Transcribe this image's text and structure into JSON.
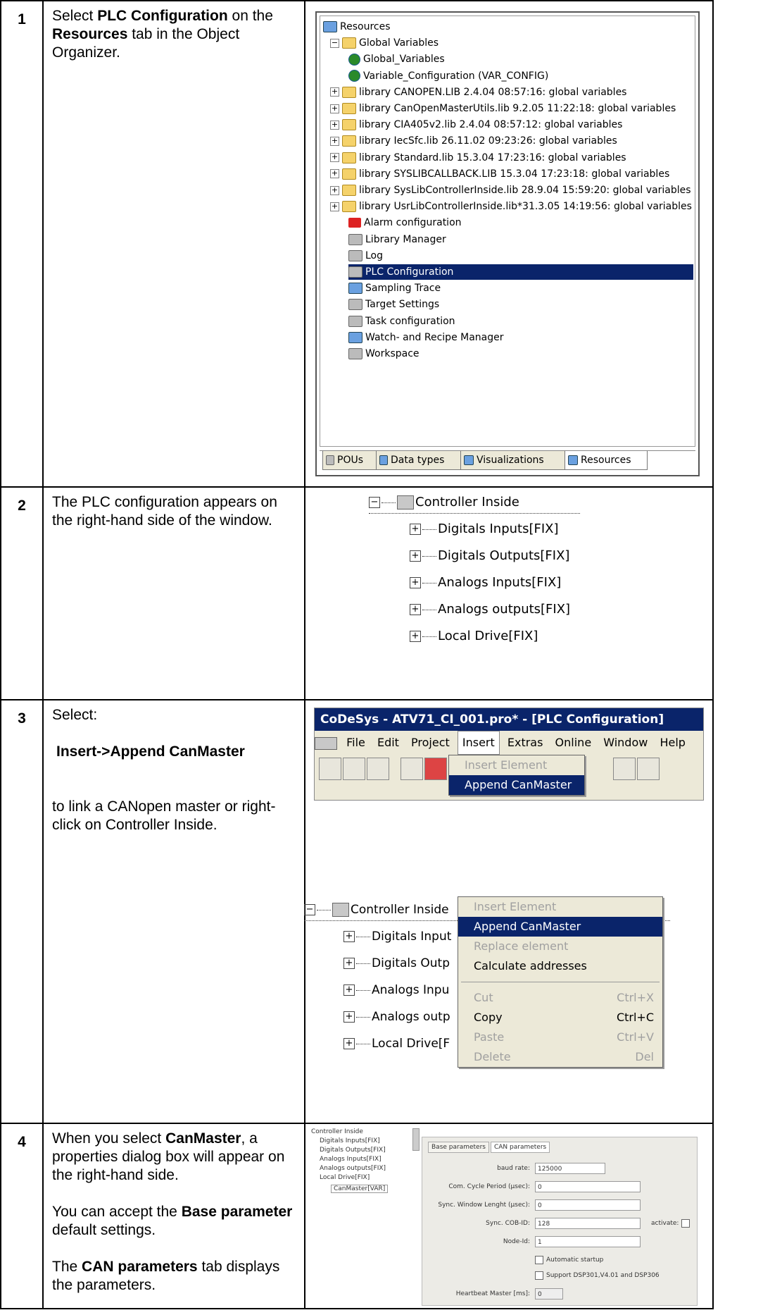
{
  "steps": [
    {
      "number": "1",
      "desc_pre": "Select ",
      "desc_b1": "PLC Configuration",
      "desc_mid": " on the ",
      "desc_b2": "Resources",
      "desc_post": " tab in the Object Organizer."
    },
    {
      "number": "2",
      "desc": "The PLC configuration appears on the right-hand side of the window."
    },
    {
      "number": "3",
      "desc_line1": "Select:",
      "desc_bold": "Insert->Append CanMaster",
      "desc_line3": "to link a CANopen master or right-click on Controller Inside."
    },
    {
      "number": "4",
      "p1_pre": "When you select ",
      "p1_bold": "CanMaster",
      "p1_post": ", a properties dialog box will appear on the right-hand side.",
      "p2_pre": "You can accept the ",
      "p2_bold": "Base parameter",
      "p2_post": " default settings.",
      "p3_pre": "The ",
      "p3_bold": "CAN parameters",
      "p3_post": " tab displays the parameters."
    }
  ],
  "resources_tree": {
    "items": [
      "Resources",
      "Global Variables",
      "Global_Variables",
      "Variable_Configuration (VAR_CONFIG)",
      "library CANOPEN.LIB 2.4.04 08:57:16: global variables",
      "library CanOpenMasterUtils.lib 9.2.05 11:22:18: global variables",
      "library CIA405v2.lib 2.4.04 08:57:12: global variables",
      "library IecSfc.lib 26.11.02 09:23:26: global variables",
      "library Standard.lib 15.3.04 17:23:16: global variables",
      "library SYSLIBCALLBACK.LIB 15.3.04 17:23:18: global variables",
      "library SysLibControllerInside.lib 28.9.04 15:59:20: global variables",
      "library UsrLibControllerInside.lib*31.3.05 14:19:56: global variables",
      "Alarm configuration",
      "Library Manager",
      "Log",
      "PLC Configuration",
      "Sampling Trace",
      "Target Settings",
      "Task configuration",
      "Watch- and Recipe Manager",
      "Workspace"
    ],
    "tabs": [
      "POUs",
      "Data types",
      "Visualizations",
      "Resources"
    ]
  },
  "plc_tree": {
    "root": "Controller Inside",
    "children": [
      "Digitals Inputs[FIX]",
      "Digitals Outputs[FIX]",
      "Analogs Inputs[FIX]",
      "Analogs outputs[FIX]",
      "Local Drive[FIX]"
    ]
  },
  "codesys": {
    "title": "CoDeSys - ATV71_CI_001.pro* - [PLC Configuration]",
    "menu": [
      "File",
      "Edit",
      "Project",
      "Insert",
      "Extras",
      "Online",
      "Window",
      "Help"
    ],
    "insert_menu": [
      "Insert Element",
      "Append CanMaster"
    ],
    "tree_root": "Controller Inside",
    "tree_children": [
      "Digitals Input",
      "Digitals Outp",
      "Analogs Inpu",
      "Analogs outp",
      "Local Drive[F"
    ],
    "context_menu": [
      {
        "label": "Insert Element",
        "shortcut": ""
      },
      {
        "label": "Append CanMaster",
        "shortcut": ""
      },
      {
        "label": "Replace element",
        "shortcut": ""
      },
      {
        "label": "Calculate addresses",
        "shortcut": ""
      },
      {
        "label": "Cut",
        "shortcut": "Ctrl+X"
      },
      {
        "label": "Copy",
        "shortcut": "Ctrl+C"
      },
      {
        "label": "Paste",
        "shortcut": "Ctrl+V"
      },
      {
        "label": "Delete",
        "shortcut": "Del"
      }
    ]
  },
  "canmaster": {
    "tree": [
      "Controller Inside",
      "Digitals Inputs[FIX]",
      "Digitals Outputs[FIX]",
      "Analogs Inputs[FIX]",
      "Analogs outputs[FIX]",
      "Local Drive[FIX]",
      "CanMaster[VAR]"
    ],
    "tabs": [
      "Base parameters",
      "CAN parameters"
    ],
    "fields": [
      {
        "label": "baud rate:",
        "value": "125000"
      },
      {
        "label": "Com. Cycle Period (µsec):",
        "value": "0"
      },
      {
        "label": "Sync. Window Lenght (µsec):",
        "value": "0"
      },
      {
        "label": "Sync. COB-ID:",
        "value": "128"
      },
      {
        "label": "Node-Id:",
        "value": "1"
      }
    ],
    "activate_label": "activate:",
    "checkboxes": [
      "Automatic startup",
      "Support DSP301,V4.01 and DSP306"
    ],
    "heartbeat_label": "Heartbeat Master [ms]:",
    "heartbeat_value": "0"
  }
}
